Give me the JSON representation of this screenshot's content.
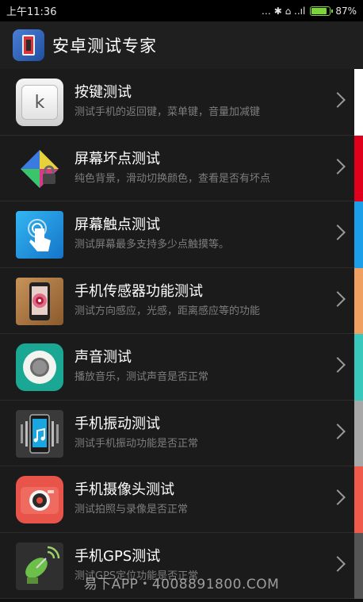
{
  "status_bar": {
    "time": "上午11:36",
    "icons_text": "… ✱ ⌂ ..ıl",
    "battery": "87%",
    "battery_level": 0.87
  },
  "app_bar": {
    "title": "安卓测试专家"
  },
  "items": [
    {
      "title": "按键测试",
      "desc": "测试手机的返回键，菜单键，音量加减键",
      "icon": "keyboard-key-icon",
      "key_label": "k",
      "color": "#ffffff"
    },
    {
      "title": "屏幕坏点测试",
      "desc": "纯色背景，滑动切换颜色，查看是否有坏点",
      "icon": "color-diamond-lock-icon",
      "color": "#e0001b"
    },
    {
      "title": "屏幕触点测试",
      "desc": "测试屏幕最多支持多少点触摸等。",
      "icon": "touch-hand-icon",
      "color": "#1b9fe8"
    },
    {
      "title": "手机传感器功能测试",
      "desc": "测试方向感应，光感，距离感应等的功能",
      "icon": "sensor-phone-icon",
      "color": "#f0a060"
    },
    {
      "title": "声音测试",
      "desc": "播放音乐，测试声音是否正常",
      "icon": "speaker-icon",
      "color": "#38c8bc"
    },
    {
      "title": "手机振动测试",
      "desc": "测试手机振动功能是否正常",
      "icon": "vibrate-phone-icon",
      "color": "#a8a8a8"
    },
    {
      "title": "手机摄像头测试",
      "desc": "测试拍照与录像是否正常",
      "icon": "camera-icon",
      "color": "#ef5a4a"
    },
    {
      "title": "手机GPS测试",
      "desc": "测试GPS定位功能是否正常",
      "icon": "satellite-dish-icon",
      "color": "#555555"
    }
  ],
  "watermark": "易下APP・4008891800.COM"
}
